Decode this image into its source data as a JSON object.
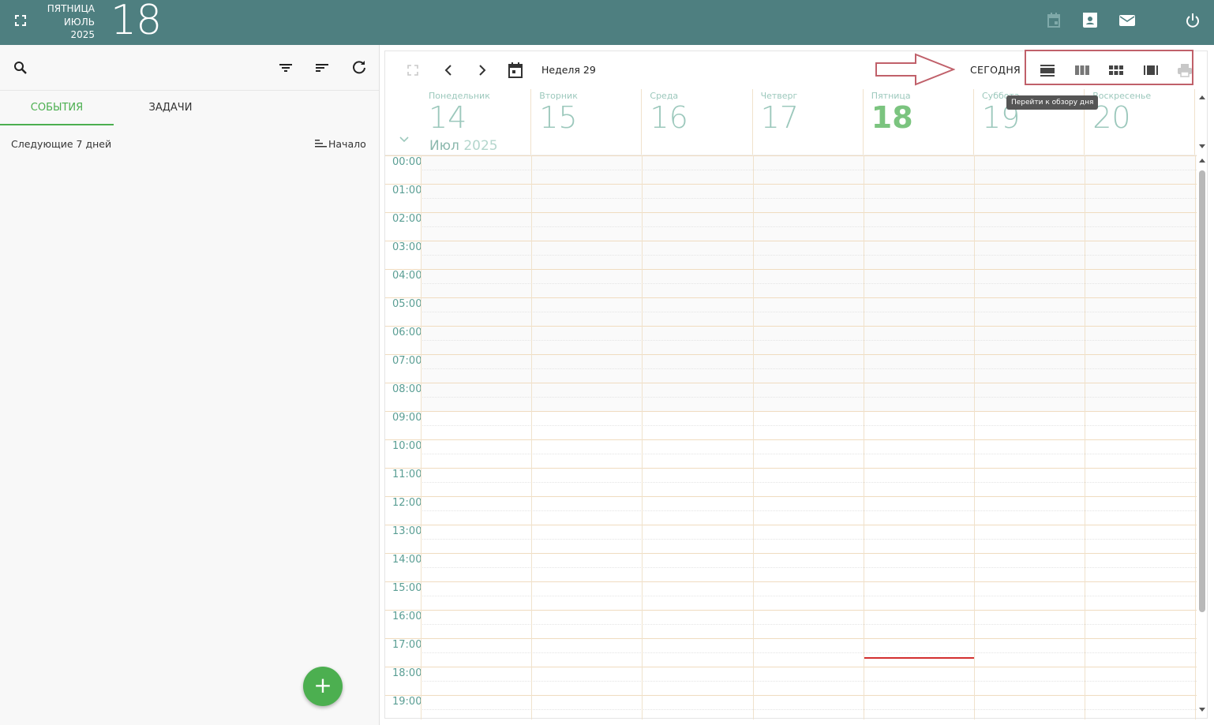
{
  "header": {
    "weekday": "ПЯТНИЦА",
    "month": "ИЮЛЬ",
    "year": "2025",
    "day": "18",
    "icons": [
      "expand-icon",
      "calendar-icon",
      "contacts-icon",
      "mail-icon",
      "power-icon"
    ]
  },
  "sidebar": {
    "tabs": [
      {
        "label": "СОБЫТИЯ",
        "active": true
      },
      {
        "label": "ЗАДАЧИ",
        "active": false
      }
    ],
    "range_label": "Следующие 7 дней",
    "sort_label": "Начало",
    "add_button": "+"
  },
  "calendar": {
    "week_label": "Неделя 29",
    "today_label": "СЕГОДНЯ",
    "tooltip": "Перейти к обзору дня",
    "month_label": "Июл",
    "year_label": "2025",
    "days": [
      {
        "name": "Понедельник",
        "num": "14",
        "today": false
      },
      {
        "name": "Вторник",
        "num": "15",
        "today": false
      },
      {
        "name": "Среда",
        "num": "16",
        "today": false
      },
      {
        "name": "Четверг",
        "num": "17",
        "today": false
      },
      {
        "name": "Пятница",
        "num": "18",
        "today": true
      },
      {
        "name": "Суббота",
        "num": "19",
        "today": false
      },
      {
        "name": "Воскресенье",
        "num": "20",
        "today": false
      }
    ],
    "hours": [
      "00:00",
      "01:00",
      "02:00",
      "03:00",
      "04:00",
      "05:00",
      "06:00",
      "07:00",
      "08:00",
      "09:00",
      "10:00",
      "11:00",
      "12:00",
      "13:00",
      "14:00",
      "15:00",
      "16:00",
      "17:00",
      "18:00",
      "19:00"
    ]
  },
  "colors": {
    "topbar": "#4e7f80",
    "accent": "#4caf50",
    "callout": "#c0606a",
    "now_line": "#d32f2f"
  }
}
